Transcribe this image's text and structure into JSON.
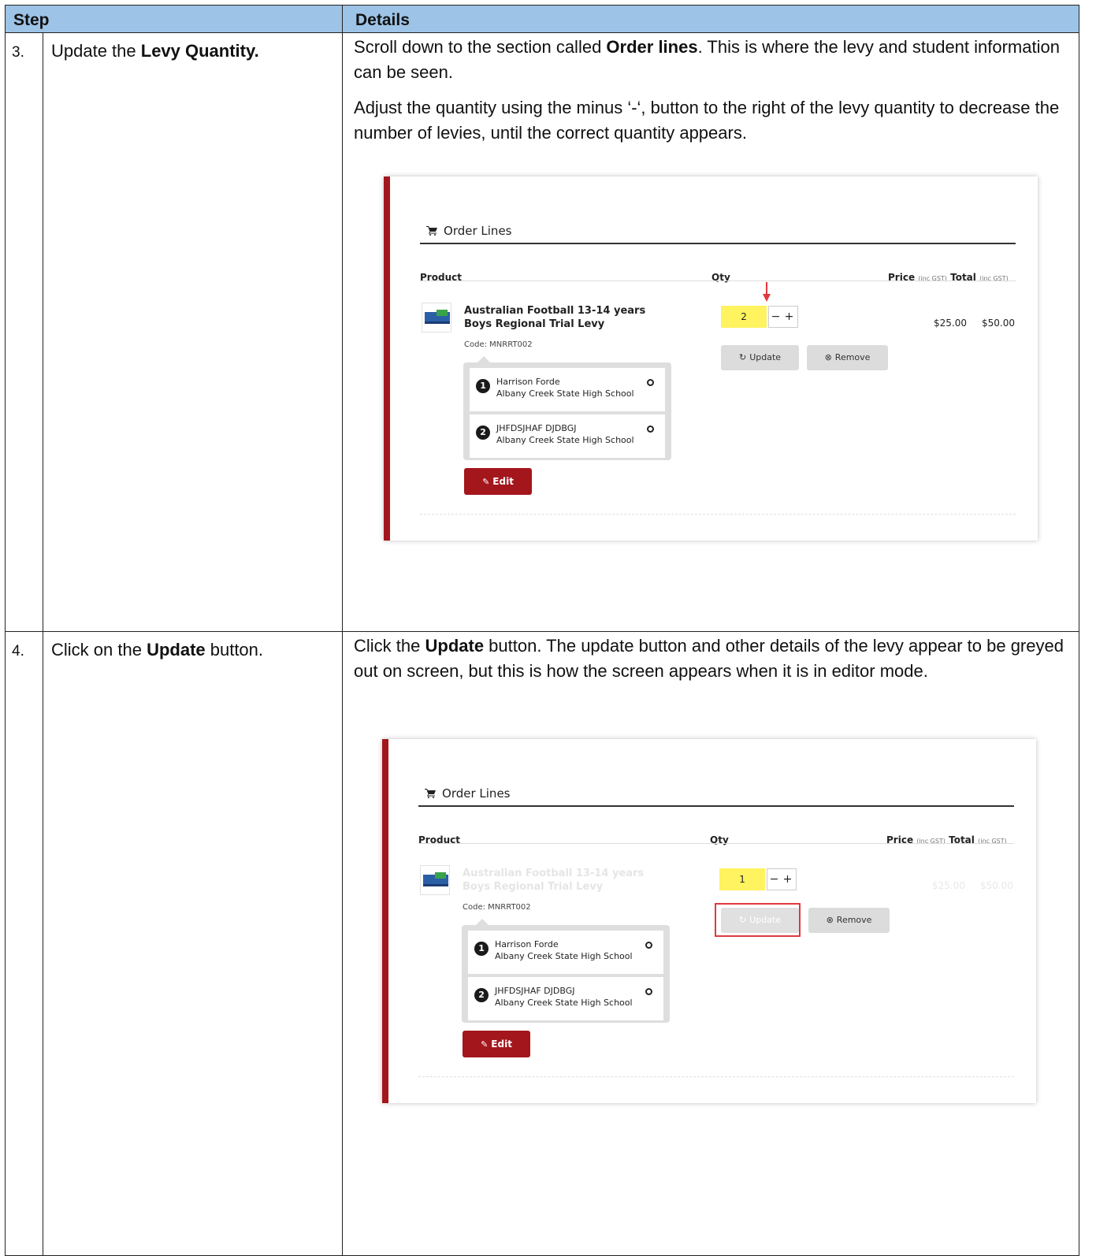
{
  "table": {
    "headers": {
      "step": "Step",
      "details": "Details"
    },
    "rows": [
      {
        "num": "3.",
        "step_prefix": "Update the ",
        "step_bold": "Levy Quantity.",
        "step_suffix": "",
        "p1": {
          "a": "Scroll down to the section called ",
          "b": "Order lines",
          "c": ". This is where the levy and student information can be seen."
        },
        "p2": "Adjust the quantity using the minus ‘-‘, button to the right of the levy quantity to decrease the number of levies, until the correct quantity appears.",
        "shot": {
          "title": "Order Lines",
          "col_product": "Product",
          "col_qty": "Qty",
          "col_price": "Price",
          "col_price_sub": "(inc GST)",
          "col_total": "Total",
          "col_total_sub": "(inc GST)",
          "product_name": "Australian Football 13-14 years Boys Regional Trial Levy",
          "product_code": "Code: MNRRT002",
          "qty": "2",
          "minus": "−",
          "plus": "+",
          "price": "$25.00",
          "total": "$50.00",
          "update": "Update",
          "remove": "Remove",
          "students": [
            {
              "num": "1",
              "name": "Harrison Forde",
              "school": "Albany Creek State High School"
            },
            {
              "num": "2",
              "name": "JHFDSJHAF DJDBGJ",
              "school": "Albany Creek State High School"
            }
          ],
          "edit": "Edit"
        }
      },
      {
        "num": "4.",
        "step_prefix": "Click on the ",
        "step_bold": "Update",
        "step_suffix": " button.",
        "p1": {
          "a": "Click the ",
          "b": "Update",
          "c": " button. The update button and other details of the levy appear to be greyed out on screen, but this is how the screen appears when it is in editor mode."
        },
        "shot": {
          "title": "Order Lines",
          "col_product": "Product",
          "col_qty": "Qty",
          "col_price": "Price",
          "col_price_sub": "(inc GST)",
          "col_total": "Total",
          "col_total_sub": "(inc GST)",
          "product_name": "Australian Football 13-14 years Boys Regional Trial Levy",
          "product_code": "Code: MNRRT002",
          "qty": "1",
          "minus": "−",
          "plus": "+",
          "price": "$25.00",
          "total": "$50.00",
          "update": "Update",
          "remove": "Remove",
          "students": [
            {
              "num": "1",
              "name": "Harrison Forde",
              "school": "Albany Creek State High School"
            },
            {
              "num": "2",
              "name": "JHFDSJHAF DJDBGJ",
              "school": "Albany Creek State High School"
            }
          ],
          "edit": "Edit"
        }
      }
    ]
  },
  "colors": {
    "header_bg": "#9dc3e6",
    "brand_red": "#a3161c",
    "highlight_yellow": "#fff35f",
    "annotation_red": "#e0393e"
  },
  "icons": [
    "cart-icon",
    "refresh-icon",
    "remove-circle-icon",
    "pencil-icon",
    "red-arrow-down-icon",
    "close-circle-icon"
  ]
}
